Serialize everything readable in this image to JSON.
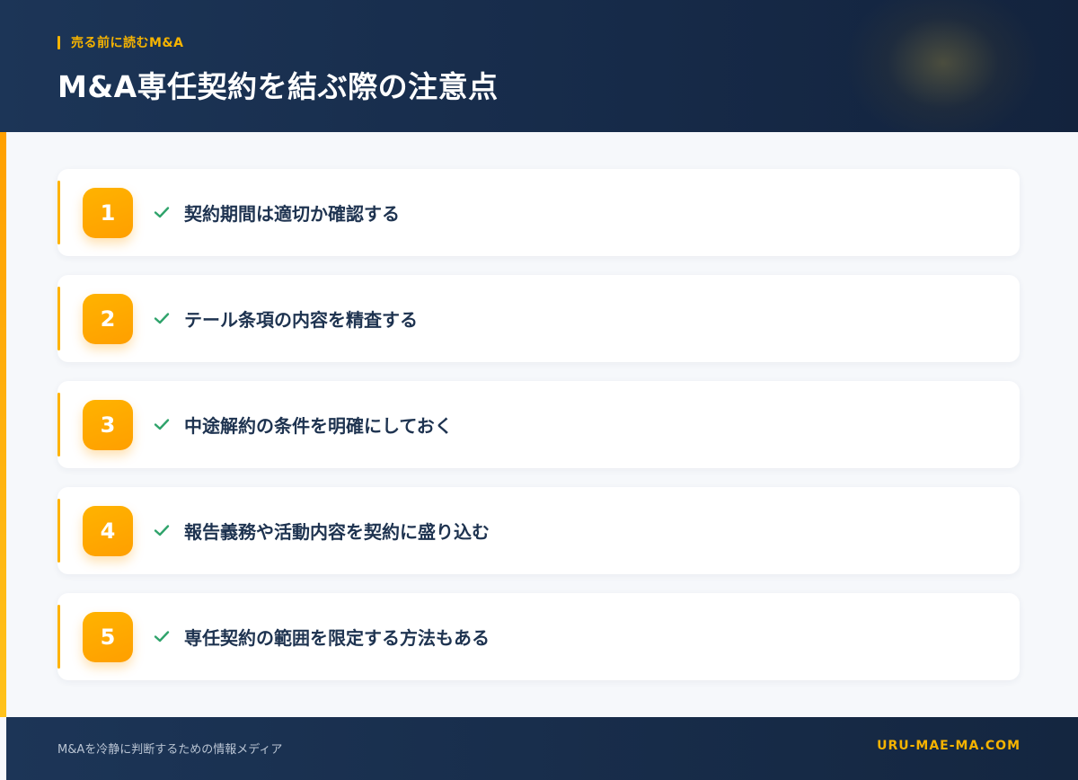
{
  "header": {
    "eyebrow": "売る前に読むM&A",
    "title": "M&A専任契約を結ぶ際の注意点"
  },
  "items": [
    {
      "number": "1",
      "label": "契約期間は適切か確認する"
    },
    {
      "number": "2",
      "label": "テール条項の内容を精査する"
    },
    {
      "number": "3",
      "label": "中途解約の条件を明確にしておく"
    },
    {
      "number": "4",
      "label": "報告義務や活動内容を契約に盛り込む"
    },
    {
      "number": "5",
      "label": "専任契約の範囲を限定する方法もある"
    }
  ],
  "footer": {
    "tagline": "M&Aを冷静に判断するための情報メディア",
    "site": "URU-MAE-MA.COM"
  },
  "colors": {
    "accent": "#f5b300",
    "navy": "#1c3557",
    "check": "#2fa36b",
    "text": "#1e3350"
  },
  "icons": {
    "item_icon": "check-icon"
  }
}
